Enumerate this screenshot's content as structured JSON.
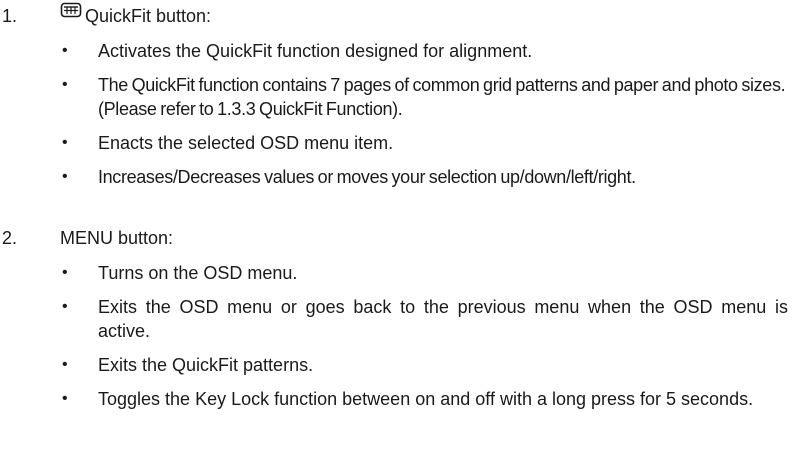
{
  "items": [
    {
      "number": "1.",
      "title": "QuickFit button:",
      "icon": "quickfit-icon",
      "bullets": [
        "Activates the QuickFit function designed for alignment.",
        "The QuickFit function contains 7 pages of common grid patterns and paper and photo sizes. (Please refer to 1.3.3 QuickFit Function).",
        "Enacts the selected OSD menu item.",
        "Increases/Decreases values or moves your selection up/down/left/right."
      ]
    },
    {
      "number": "2.",
      "title": "MENU button:",
      "bullets": [
        "Turns on the OSD menu.",
        "Exits the OSD menu or goes back to the previous menu when the OSD menu is active.",
        "Exits the QuickFit patterns.",
        "Toggles the Key Lock function between on and off with a long press for 5 seconds."
      ]
    }
  ],
  "bullet_glyph": "•"
}
